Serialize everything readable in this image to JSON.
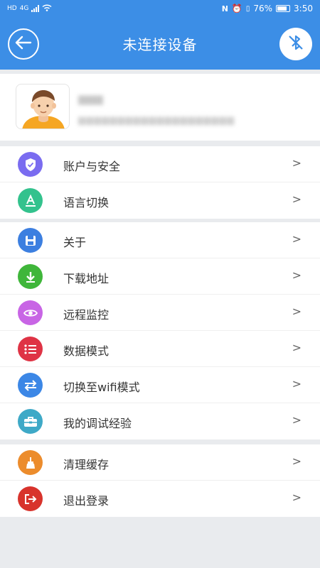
{
  "status_bar": {
    "left_text": "HD",
    "network": "4G",
    "battery": "76%",
    "time": "3:50"
  },
  "header": {
    "title": "未连接设备",
    "back_icon": "back-arrow-icon",
    "bluetooth_icon": "bluetooth-off-icon"
  },
  "profile": {
    "name": "▆▆▆",
    "account": "▆▆▆▆▆▆▆▆▆▆▆▆▆▆▆▆▆▆▆▆"
  },
  "menu": {
    "group1": [
      {
        "label": "账户与安全",
        "icon": "shield-icon",
        "color": "#7a6cf0"
      },
      {
        "label": "语言切换",
        "icon": "language-icon",
        "color": "#33c28d"
      }
    ],
    "group2": [
      {
        "label": "关于",
        "icon": "save-icon",
        "color": "#3c7fe0"
      },
      {
        "label": "下载地址",
        "icon": "download-icon",
        "color": "#3fb63a"
      },
      {
        "label": "远程监控",
        "icon": "eye-icon",
        "color": "#c865e5"
      },
      {
        "label": "数据模式",
        "icon": "list-icon",
        "color": "#df3345"
      },
      {
        "label": "切换至wifi模式",
        "icon": "switch-icon",
        "color": "#3c87e6"
      },
      {
        "label": "我的调试经验",
        "icon": "toolbox-icon",
        "color": "#3ea9c7"
      }
    ],
    "group3": [
      {
        "label": "清理缓存",
        "icon": "broom-icon",
        "color": "#ec8c2c"
      },
      {
        "label": "退出登录",
        "icon": "logout-icon",
        "color": "#d8332c"
      }
    ],
    "chevron": ">"
  }
}
